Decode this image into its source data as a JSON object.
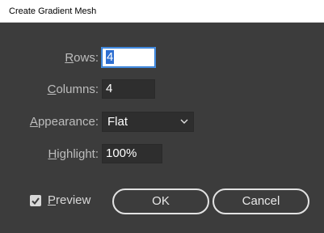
{
  "window": {
    "title": "Create Gradient Mesh"
  },
  "form": {
    "rows": {
      "label_accel": "R",
      "label_rest": "ows:",
      "value": "4"
    },
    "columns": {
      "label_accel": "C",
      "label_rest": "olumns:",
      "value": "4"
    },
    "appearance": {
      "label_accel": "A",
      "label_rest": "ppearance:",
      "value": "Flat",
      "icon": "chevron-down-icon"
    },
    "highlight": {
      "label_accel": "H",
      "label_rest": "ighlight:",
      "value": "100%"
    }
  },
  "preview": {
    "checked": true,
    "label_accel": "P",
    "label_rest": "review"
  },
  "buttons": {
    "ok": "OK",
    "cancel": "Cancel"
  },
  "colors": {
    "dialog_bg": "#3c3c3c",
    "field_bg": "#2e2e2e",
    "focus_ring": "#2e7bd6",
    "selection": "#2e6fd1"
  }
}
